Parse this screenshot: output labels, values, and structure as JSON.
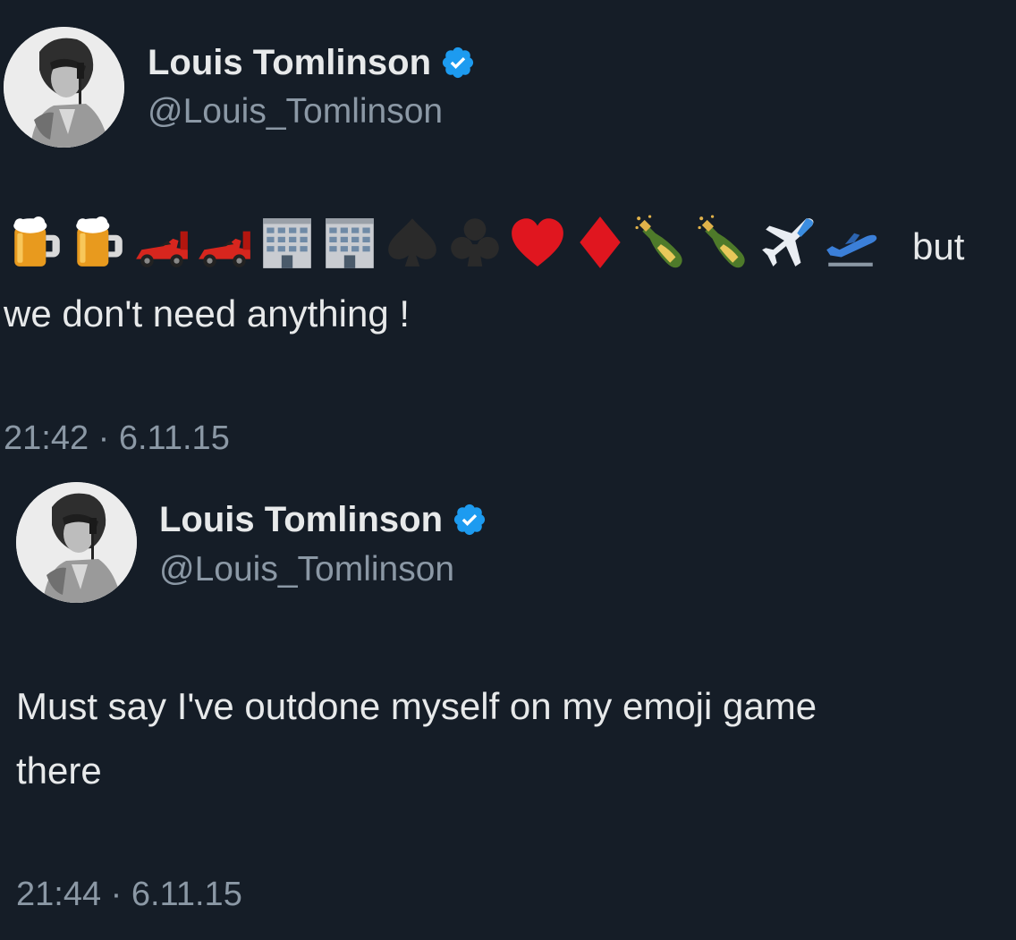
{
  "tweets": [
    {
      "display_name": "Louis Tomlinson",
      "handle": "@Louis_Tomlinson",
      "verified": true,
      "emojis": [
        "beer-mug",
        "beer-mug",
        "racing-car",
        "racing-car",
        "office-building",
        "office-building",
        "spade-suit",
        "club-suit",
        "heart-suit",
        "diamond-suit",
        "champagne-bottle",
        "champagne-bottle",
        "airplane",
        "airplane-departure"
      ],
      "text_after_emojis": "but",
      "text_line_2": "we don't need anything !",
      "time": "21:42",
      "date": "6.11.15",
      "timestamp": "21:42 · 6.11.15"
    },
    {
      "display_name": "Louis Tomlinson",
      "handle": "@Louis_Tomlinson",
      "verified": true,
      "text_line_1": "Must say I've outdone myself on my emoji game",
      "text_line_2": "there",
      "time": "21:44",
      "date": "6.11.15",
      "timestamp": "21:44 · 6.11.15"
    }
  ],
  "colors": {
    "background": "#151d27",
    "primary_text": "#e7e9ea",
    "secondary_text": "#8b98a5",
    "verified_blue": "#1d9bf0"
  }
}
